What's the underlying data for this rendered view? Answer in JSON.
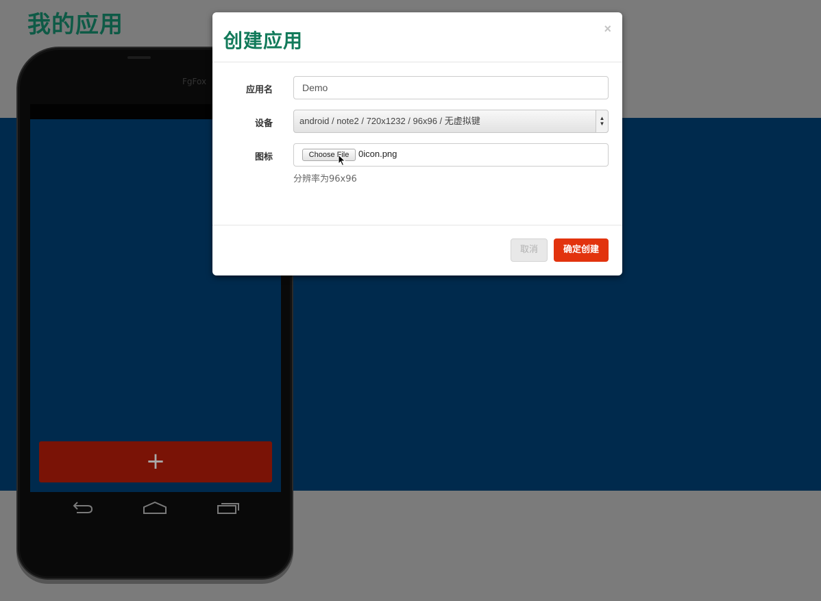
{
  "page": {
    "title": "我的应用"
  },
  "phone": {
    "brand": "FgFox",
    "add_label": "+"
  },
  "modal": {
    "title": "创建应用",
    "close_label": "×",
    "fields": {
      "app_name_label": "应用名",
      "app_name_value": "Demo",
      "device_label": "设备",
      "device_value": "android / note2 / 720x1232 / 96x96 / 无虚拟键",
      "icon_label": "图标",
      "choose_file_label": "Choose File",
      "file_name": "0icon.png",
      "icon_help": "分辨率为96x96"
    },
    "footer": {
      "cancel_label": "取消",
      "confirm_label": "确定创建"
    }
  },
  "colors": {
    "overlay_bg": "#7b7b7b",
    "accent_green": "#127a5a",
    "confirm_red": "#e2330e",
    "blue_band": "#002a4d"
  }
}
